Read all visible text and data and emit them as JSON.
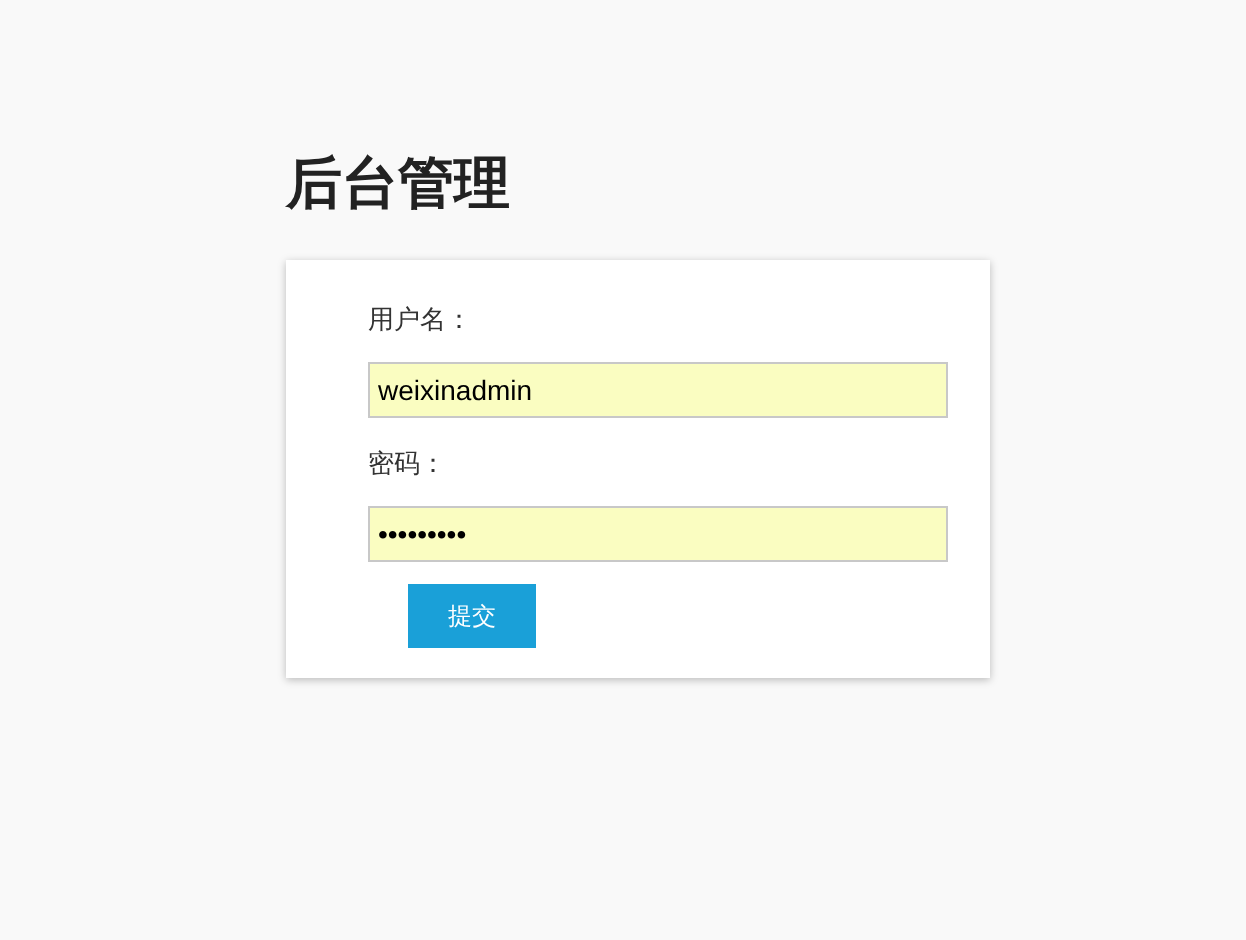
{
  "title": "后台管理",
  "form": {
    "fields": [
      {
        "label": "用户名：",
        "value": "weixinadmin"
      },
      {
        "label": "密码：",
        "value": "•••••••••"
      }
    ],
    "submit": "提交"
  }
}
